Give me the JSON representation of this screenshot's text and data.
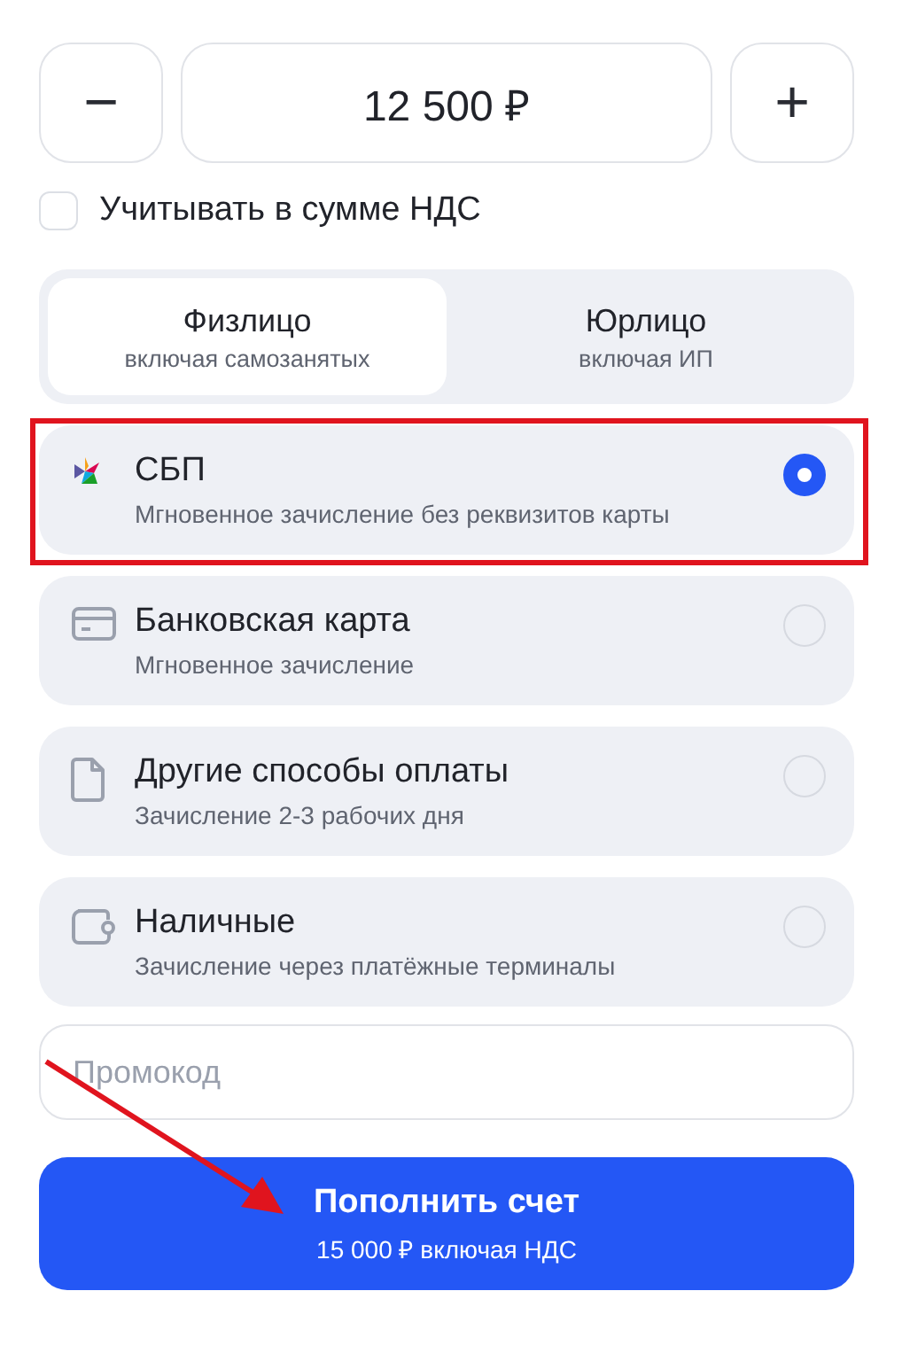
{
  "amount": {
    "value": "12 500 ₽",
    "decrease": "−",
    "increase": "+"
  },
  "vat_checkbox": {
    "label": "Учитывать в сумме НДС",
    "checked": false
  },
  "payer_tabs": [
    {
      "label": "Физлицо",
      "sublabel": "включая самозанятых",
      "selected": true
    },
    {
      "label": "Юрлицо",
      "sublabel": "включая ИП",
      "selected": false
    }
  ],
  "methods": [
    {
      "kind": "sbp",
      "title": "СБП",
      "subtitle": "Мгновенное зачисление без реквизитов карты",
      "selected": true,
      "highlighted": true
    },
    {
      "kind": "card",
      "title": "Банковская карта",
      "subtitle": "Мгновенное зачисление",
      "selected": false,
      "highlighted": false
    },
    {
      "kind": "document",
      "title": "Другие способы оплаты",
      "subtitle": "Зачисление 2-3 рабочих дня",
      "selected": false,
      "highlighted": false
    },
    {
      "kind": "wallet",
      "title": "Наличные",
      "subtitle": "Зачисление через платёжные терминалы",
      "selected": false,
      "highlighted": false
    }
  ],
  "promo": {
    "placeholder": "Промокод"
  },
  "submit": {
    "label": "Пополнить счет",
    "sublabel": "15 000 ₽ включая НДС"
  },
  "pointer_arrow": true
}
